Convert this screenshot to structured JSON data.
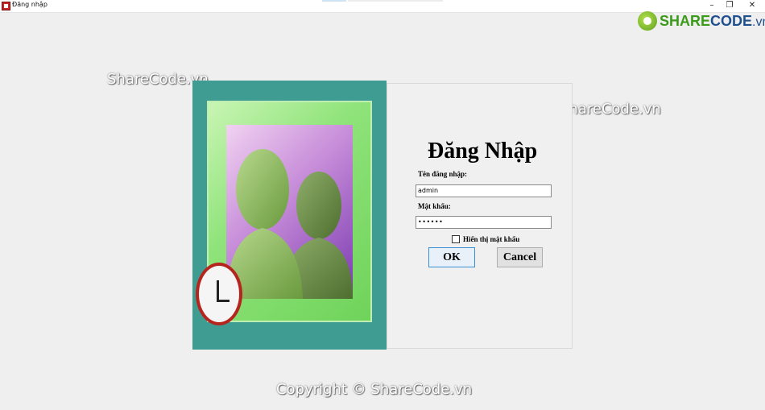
{
  "window": {
    "title": "Đăng nhập",
    "minimize": "–",
    "restore": "❐",
    "close": "✕"
  },
  "watermarks": {
    "top_left": "ShareCode.vn",
    "top_right": "ShareCode.vn",
    "copyright": "Copyright © ShareCode.vn"
  },
  "logo": {
    "share": "SHARE",
    "code": "CODE",
    "vn": ".vn"
  },
  "form": {
    "heading": "Đăng Nhập",
    "username_label": "Tên đăng nhập:",
    "username_value": "admin",
    "password_label": "Mật khẩu:",
    "password_value": "••••••",
    "show_password_label": "Hiển thị mật khẩu",
    "ok_label": "OK",
    "cancel_label": "Cancel"
  }
}
